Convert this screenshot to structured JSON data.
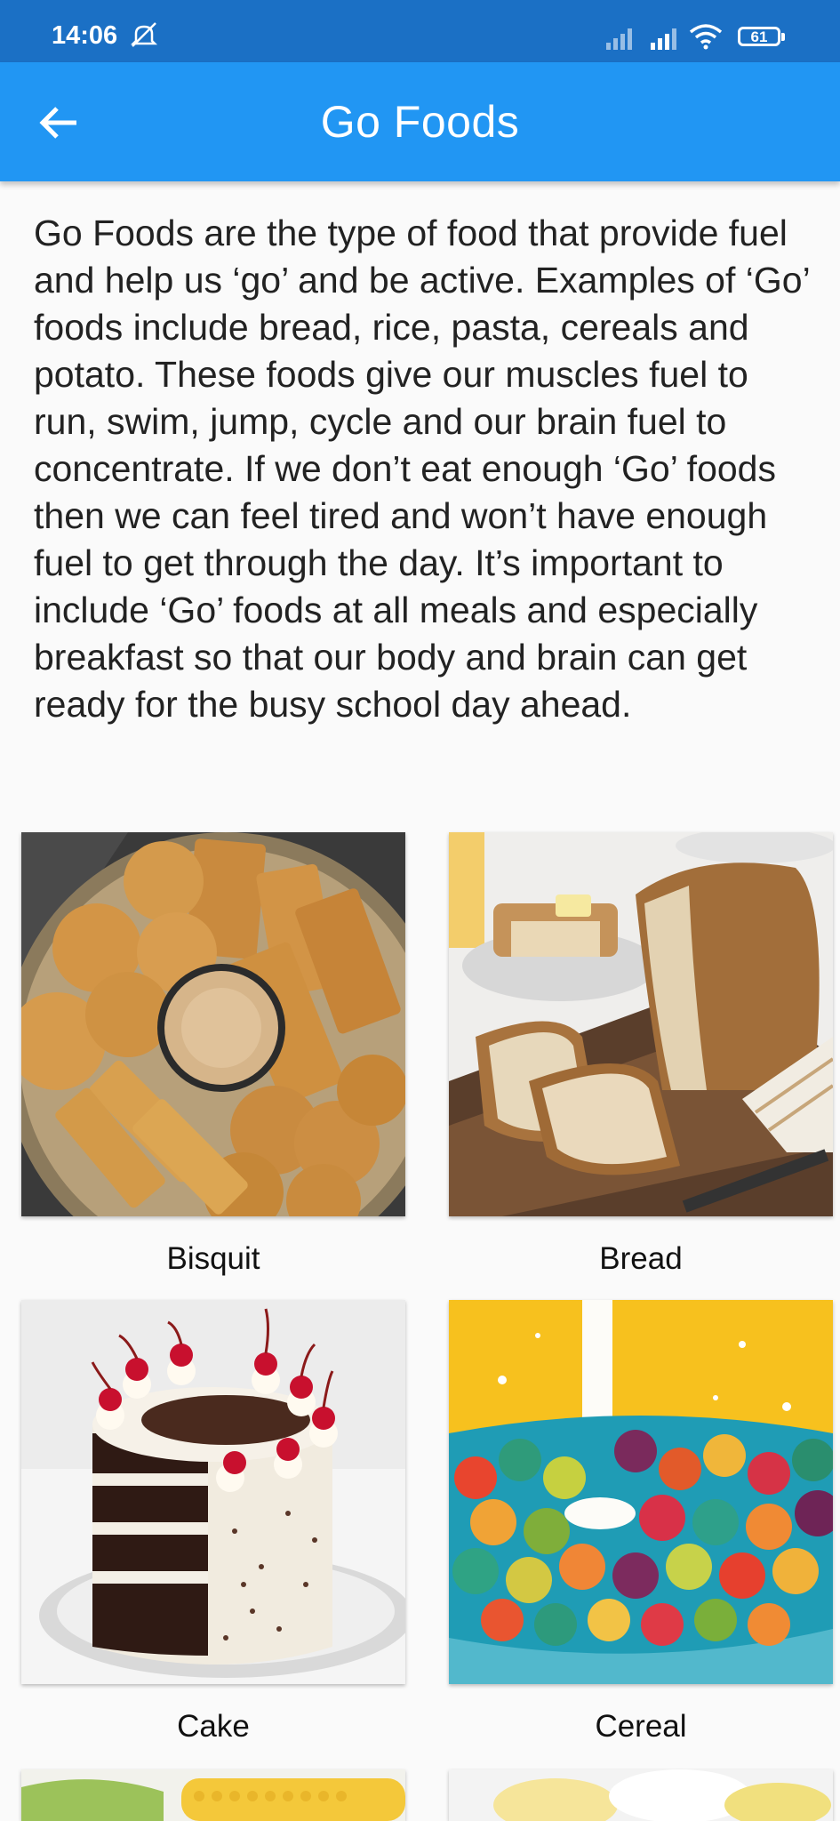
{
  "status_bar": {
    "time": "14:06",
    "battery": "61",
    "icons": [
      "mute-icon",
      "signal-icon",
      "signal-icon",
      "wifi-icon",
      "battery-icon"
    ]
  },
  "app_bar": {
    "title": "Go Foods",
    "back_icon": "arrow-back-icon",
    "color": "#2196f3"
  },
  "description": "Go Foods are the type of food that provide fuel and help us ‘go’ and be active. Examples of ‘Go’ foods include bread, rice, pasta, cereals and potato. These foods give our muscles fuel to run, swim, jump, cycle and our brain fuel to concentrate. If we don’t eat enough ‘Go’ foods then we can feel tired and won’t have enough fuel to get through the day. It’s important to include ‘Go’ foods at all meals and especially breakfast so that our body and brain can get ready for the busy school day ahead.",
  "foods": [
    {
      "label": "Bisquit"
    },
    {
      "label": "Bread"
    },
    {
      "label": "Cake"
    },
    {
      "label": "Cereal"
    },
    {
      "label": ""
    },
    {
      "label": ""
    }
  ]
}
